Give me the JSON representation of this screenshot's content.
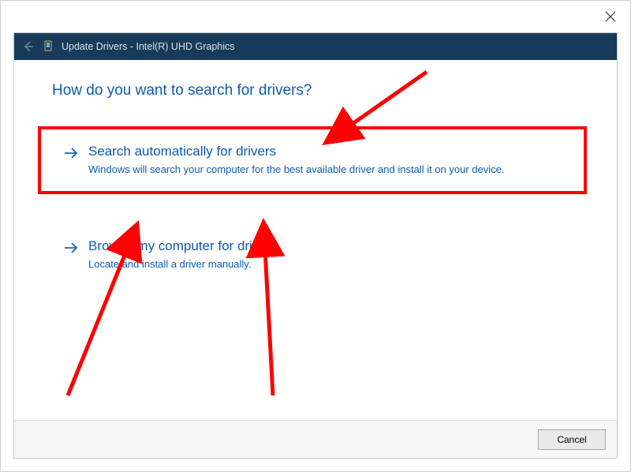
{
  "window": {
    "title": "Update Drivers - Intel(R) UHD Graphics"
  },
  "heading": "How do you want to search for drivers?",
  "options": {
    "auto": {
      "title": "Search automatically for drivers",
      "desc": "Windows will search your computer for the best available driver and install it on your device."
    },
    "browse": {
      "title": "Browse my computer for drivers",
      "desc": "Locate and install a driver manually."
    }
  },
  "buttons": {
    "cancel": "Cancel"
  },
  "annotation": {
    "color": "#ff0000"
  }
}
